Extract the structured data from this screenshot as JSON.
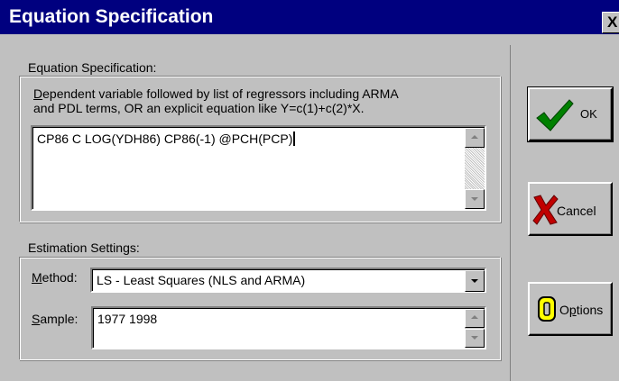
{
  "window": {
    "title": "Equation Specification",
    "close_label": "X"
  },
  "equation_group": {
    "label_pre": "Equation Specification:",
    "hint_line1_first": "D",
    "hint_line1_rest": "ependent variable followed by list of regressors including ARMA",
    "hint_line2": "and PDL terms, OR an explicit equation like Y=c(1)+c(2)*X.",
    "value": "CP86 C LOG(YDH86) CP86(-1) @PCH(PCP)"
  },
  "estimation_group": {
    "label_pre": "Estimation Settin",
    "label_u": "g",
    "label_post": "s:",
    "method_label_u": "M",
    "method_label_rest": "ethod:",
    "method_value": "LS  -  Least Squares (NLS and ARMA)",
    "sample_label_u": "S",
    "sample_label_rest": "ample:",
    "sample_value": "1977 1998"
  },
  "buttons": {
    "ok_label": "OK",
    "cancel_label": "Cancel",
    "options_pre": "O",
    "options_u": "p",
    "options_post": "tions"
  },
  "icons": {
    "ok": "checkmark-icon",
    "cancel": "x-mark-icon",
    "options": "options-o-icon"
  },
  "colors": {
    "titlebar": "#00007f",
    "face": "#c0c0c0",
    "check": "#008000",
    "cancel_x": "#c00000",
    "options_o": "#ffff00"
  }
}
